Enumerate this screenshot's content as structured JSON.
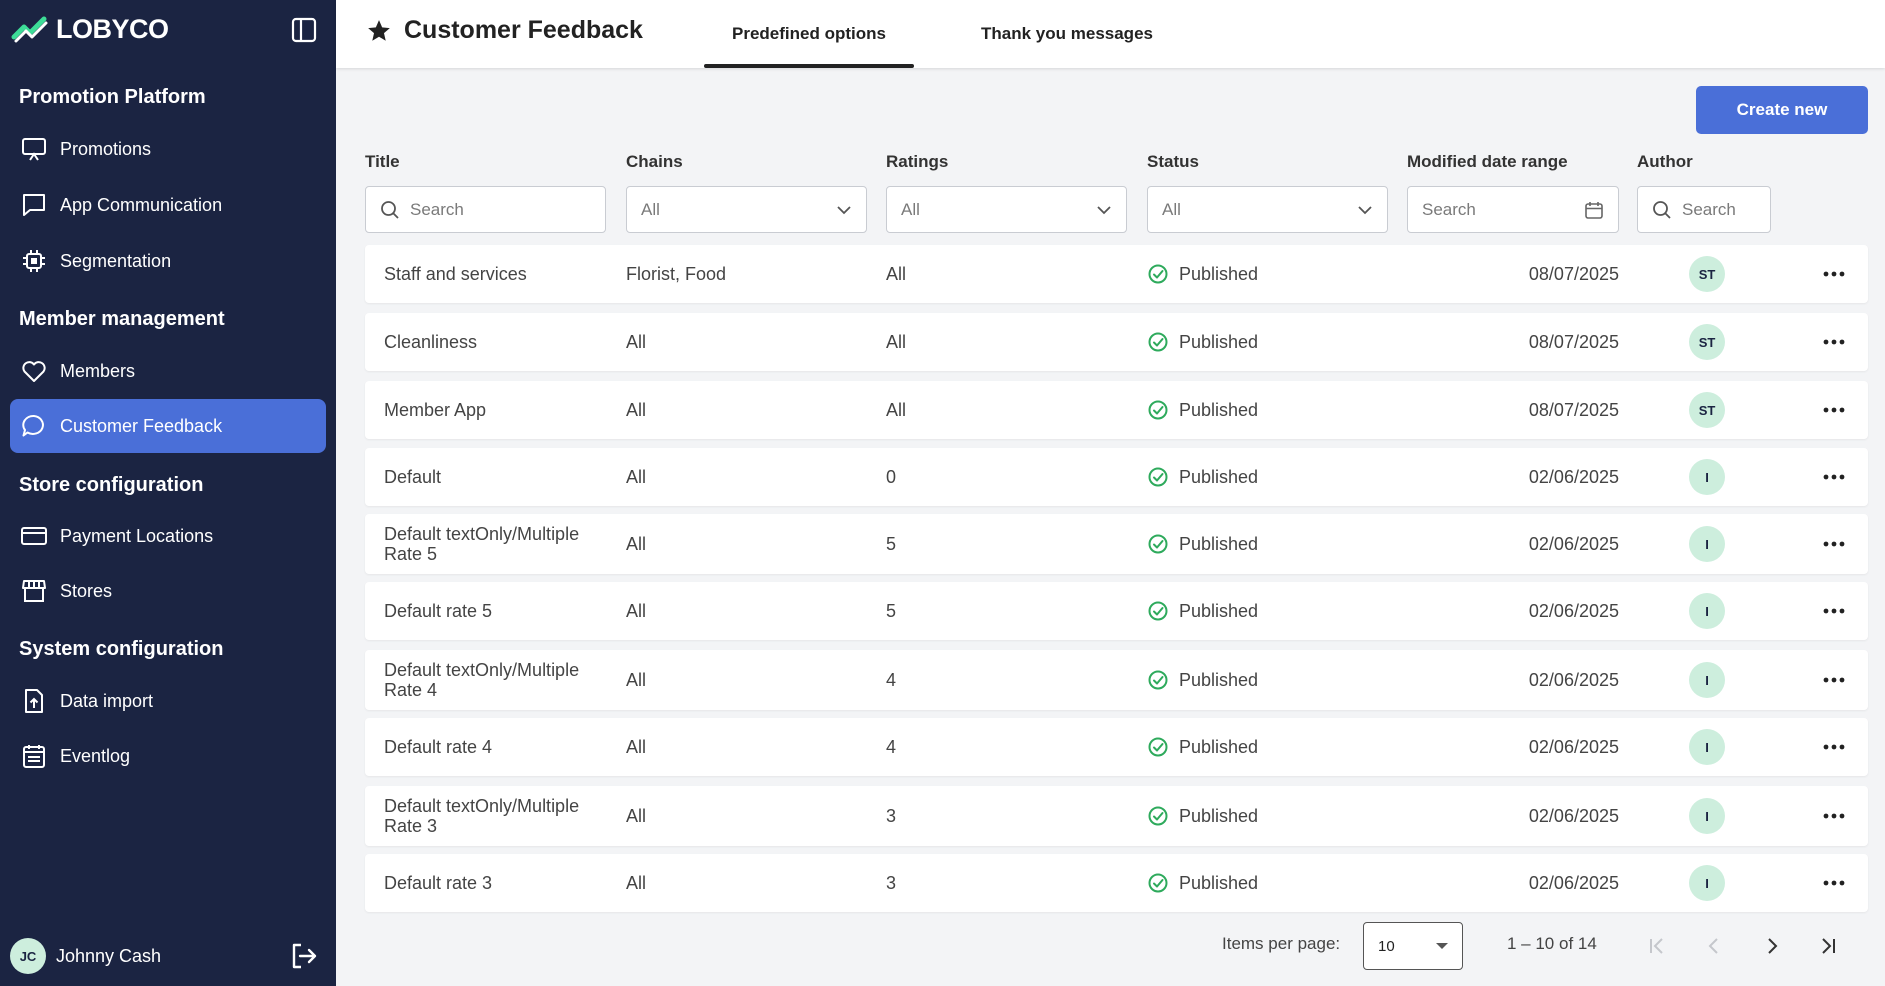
{
  "brand": {
    "name": "LOBYCO"
  },
  "sidebar": {
    "sections": [
      {
        "title": "Promotion Platform",
        "items": [
          {
            "label": "Promotions",
            "icon": "presentation-icon"
          },
          {
            "label": "App Communication",
            "icon": "chat-square-icon"
          },
          {
            "label": "Segmentation",
            "icon": "chip-icon"
          }
        ]
      },
      {
        "title": "Member management",
        "items": [
          {
            "label": "Members",
            "icon": "heart-icon"
          },
          {
            "label": "Customer Feedback",
            "icon": "chat-bubble-icon",
            "active": true
          }
        ]
      },
      {
        "title": "Store configuration",
        "items": [
          {
            "label": "Payment Locations",
            "icon": "credit-card-icon"
          },
          {
            "label": "Stores",
            "icon": "storefront-icon"
          }
        ]
      },
      {
        "title": "System configuration",
        "items": [
          {
            "label": "Data import",
            "icon": "file-upload-icon"
          },
          {
            "label": "Eventlog",
            "icon": "calendar-list-icon"
          }
        ]
      }
    ],
    "user": {
      "initials": "JC",
      "name": "Johnny Cash"
    }
  },
  "header": {
    "title": "Customer Feedback",
    "tabs": [
      {
        "label": "Predefined options",
        "active": true
      },
      {
        "label": "Thank you messages",
        "active": false
      }
    ]
  },
  "toolbar": {
    "create_label": "Create new"
  },
  "filters": {
    "title": {
      "label": "Title",
      "placeholder": "Search"
    },
    "chains": {
      "label": "Chains",
      "value": "All"
    },
    "ratings": {
      "label": "Ratings",
      "value": "All"
    },
    "status": {
      "label": "Status",
      "value": "All"
    },
    "modified": {
      "label": "Modified date range",
      "placeholder": "Search"
    },
    "author": {
      "label": "Author",
      "placeholder": "Search"
    }
  },
  "rows": [
    {
      "title": "Staff and services",
      "chains": "Florist, Food",
      "ratings": "All",
      "status": "Published",
      "date": "08/07/2025",
      "author": "ST"
    },
    {
      "title": "Cleanliness",
      "chains": "All",
      "ratings": "All",
      "status": "Published",
      "date": "08/07/2025",
      "author": "ST"
    },
    {
      "title": "Member App",
      "chains": "All",
      "ratings": "All",
      "status": "Published",
      "date": "08/07/2025",
      "author": "ST"
    },
    {
      "title": "Default",
      "chains": "All",
      "ratings": "0",
      "status": "Published",
      "date": "02/06/2025",
      "author": "I"
    },
    {
      "title": "Default textOnly/Multiple Rate 5",
      "chains": "All",
      "ratings": "5",
      "status": "Published",
      "date": "02/06/2025",
      "author": "I"
    },
    {
      "title": "Default rate 5",
      "chains": "All",
      "ratings": "5",
      "status": "Published",
      "date": "02/06/2025",
      "author": "I"
    },
    {
      "title": "Default textOnly/Multiple Rate 4",
      "chains": "All",
      "ratings": "4",
      "status": "Published",
      "date": "02/06/2025",
      "author": "I"
    },
    {
      "title": "Default rate 4",
      "chains": "All",
      "ratings": "4",
      "status": "Published",
      "date": "02/06/2025",
      "author": "I"
    },
    {
      "title": "Default textOnly/Multiple Rate 3",
      "chains": "All",
      "ratings": "3",
      "status": "Published",
      "date": "02/06/2025",
      "author": "I"
    },
    {
      "title": "Default rate 3",
      "chains": "All",
      "ratings": "3",
      "status": "Published",
      "date": "02/06/2025",
      "author": "I"
    }
  ],
  "pagination": {
    "items_per_page_label": "Items per page:",
    "items_per_page": "10",
    "range": "1 – 10 of 14"
  },
  "colors": {
    "sidebar_bg": "#1b2442",
    "accent": "#4a6fd8",
    "published": "#2eaa5c",
    "avatar_bg": "#cdeedd"
  }
}
